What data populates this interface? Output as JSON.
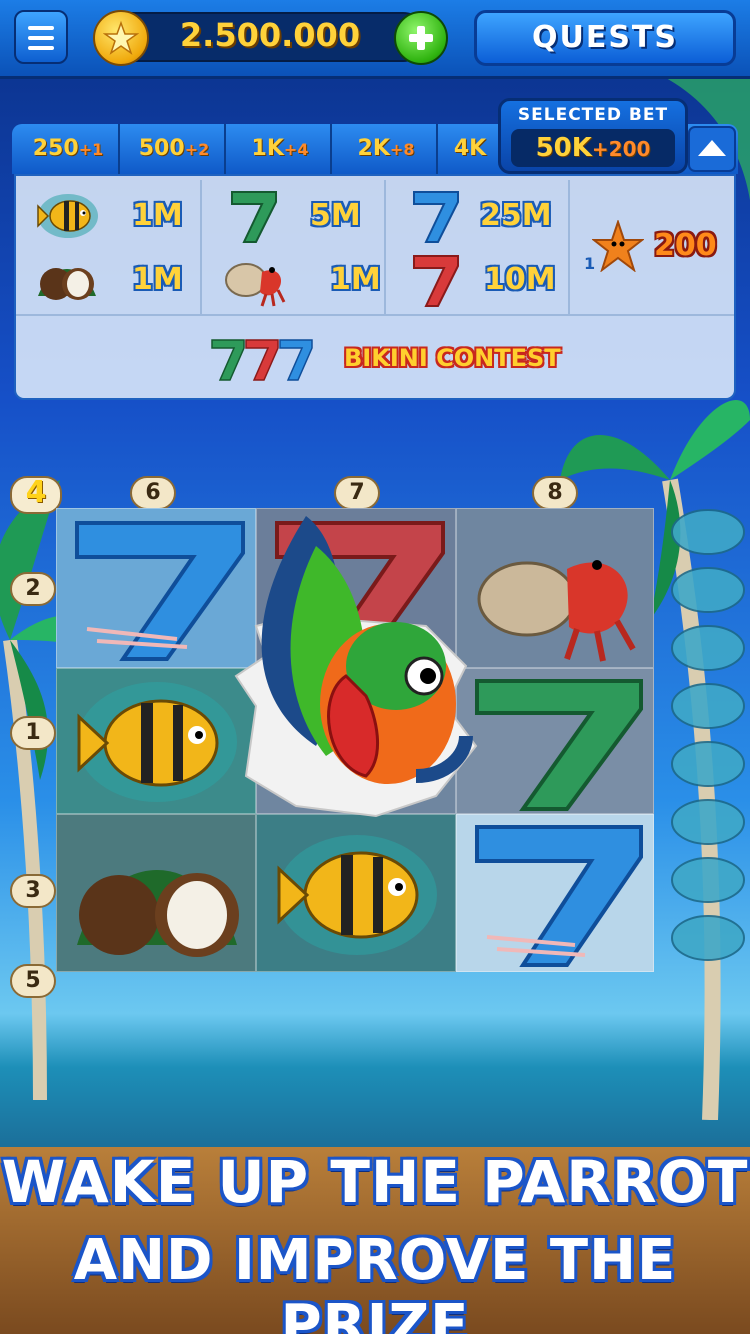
{
  "header": {
    "menu_icon": "hamburger-icon",
    "coin_icon": "star-coin-icon",
    "coin_balance": "2.500.000",
    "add_coins_icon": "plus-icon",
    "quests_label": "QUESTS"
  },
  "bet_selector": {
    "tabs": [
      {
        "bet": "250",
        "bonus": "+1"
      },
      {
        "bet": "500",
        "bonus": "+2"
      },
      {
        "bet": "1K",
        "bonus": "+4"
      },
      {
        "bet": "2K",
        "bonus": "+8"
      },
      {
        "bet": "4K",
        "bonus": ""
      }
    ],
    "selected_caption": "SELECTED BET",
    "selected_bet": "50K",
    "selected_bonus": "+200",
    "collapse_icon": "chevron-up-icon"
  },
  "paytable": {
    "rows": [
      {
        "symbol": "fish-icon",
        "value": "1M"
      },
      {
        "symbol": "coconut-icon",
        "value": "1M"
      },
      {
        "symbol": "green-seven-icon",
        "value": "5M"
      },
      {
        "symbol": "hermit-crab-icon",
        "value": "1M"
      },
      {
        "symbol": "blue-seven-icon",
        "value": "25M"
      },
      {
        "symbol": "red-seven-icon",
        "value": "10M"
      }
    ],
    "starfish": {
      "icon": "starfish-icon",
      "count": "1",
      "value": "200"
    },
    "bonus_text": "BIKINI CONTEST",
    "colors": {
      "blue_seven": "#2f8fe0",
      "red_seven": "#d83a3a",
      "green_seven": "#2e9a5a",
      "gold": "#ffd23a"
    }
  },
  "reels": {
    "line_numbers_top": [
      "6",
      "7",
      "8"
    ],
    "line_numbers_left": [
      "4",
      "2",
      "1",
      "3",
      "5"
    ],
    "active_line": "4",
    "grid": [
      [
        "blue-seven",
        "red-seven",
        "hermit-crab"
      ],
      [
        "fish",
        "parrot",
        "green-seven"
      ],
      [
        "coconut",
        "fish",
        "blue-seven"
      ]
    ],
    "feature_icon": "parrot-icon",
    "progress_icon": "turtle-shell-icon"
  },
  "promo": {
    "line1": "WAKE UP THE PARROT",
    "line2": "AND IMPROVE THE PRIZE"
  }
}
